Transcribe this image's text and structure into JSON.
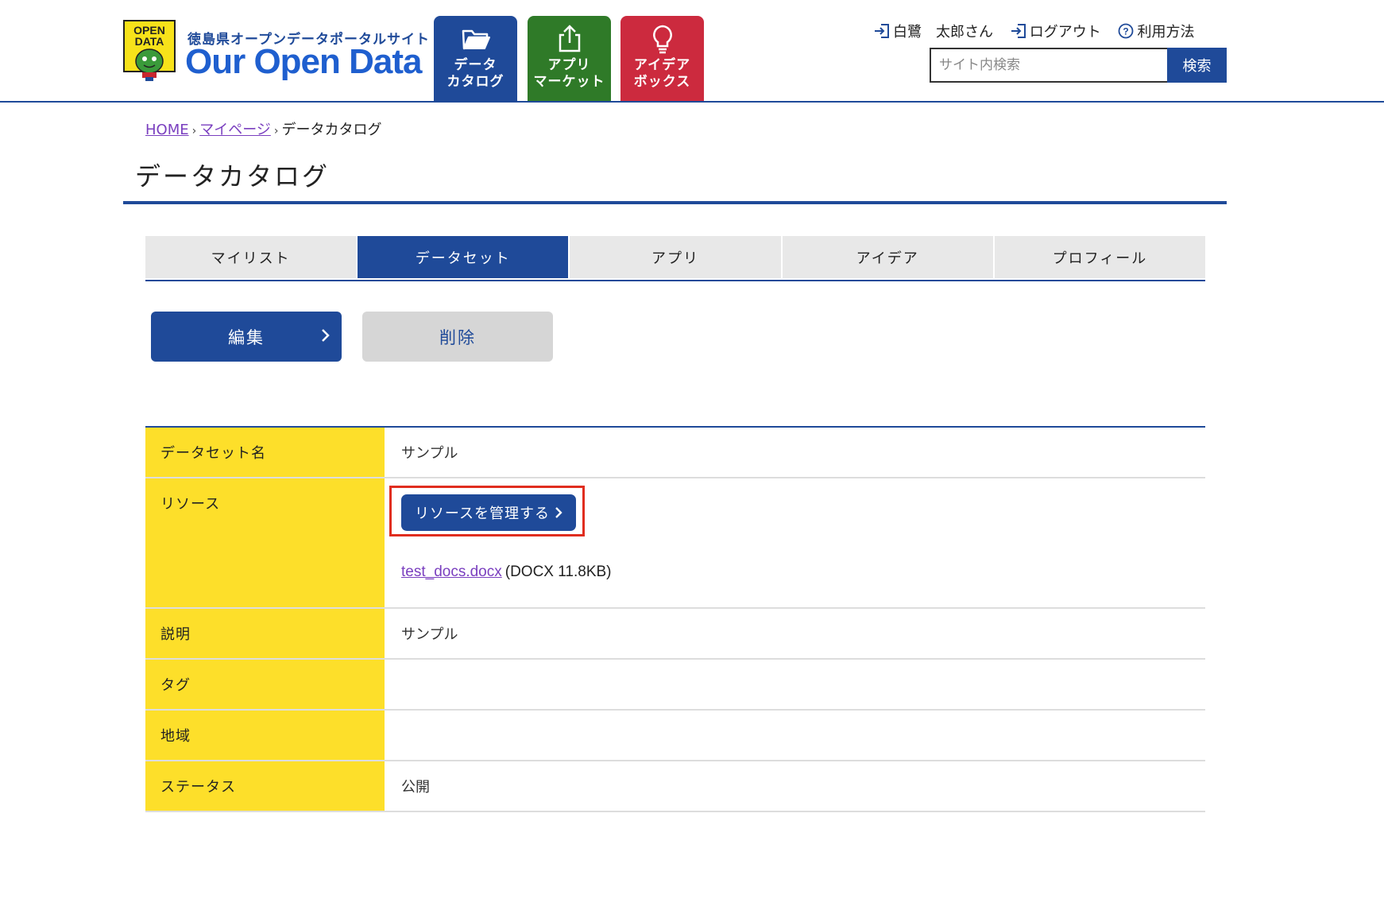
{
  "header": {
    "logo_badge_line1": "OPEN",
    "logo_badge_line2": "DATA",
    "logo_subtitle": "徳島県オープンデータポータルサイト",
    "logo_title": "Our Open Data",
    "nav": [
      {
        "label": "データ\nカタログ",
        "icon": "folder-open-icon",
        "color": "#1f4a99"
      },
      {
        "label": "アプリ\nマーケット",
        "icon": "share-upload-icon",
        "color": "#2f7a28"
      },
      {
        "label": "アイデア\nボックス",
        "icon": "lightbulb-icon",
        "color": "#cc2a3e"
      }
    ],
    "user_links": {
      "user_name": "白鷺　太郎さん",
      "logout": "ログアウト",
      "help": "利用方法"
    },
    "search": {
      "placeholder": "サイト内検索",
      "button": "検索"
    }
  },
  "breadcrumb": {
    "home": "HOME",
    "mypage": "マイページ",
    "current": "データカタログ"
  },
  "page_title": "データカタログ",
  "tabs": [
    {
      "label": "マイリスト",
      "active": false
    },
    {
      "label": "データセット",
      "active": true
    },
    {
      "label": "アプリ",
      "active": false
    },
    {
      "label": "アイデア",
      "active": false
    },
    {
      "label": "プロフィール",
      "active": false
    }
  ],
  "actions": {
    "edit": "編集",
    "delete": "削除"
  },
  "details": {
    "dataset_name_label": "データセット名",
    "dataset_name_value": "サンプル",
    "resource_label": "リソース",
    "manage_resources_button": "リソースを管理する",
    "resource_file_name": "test_docs.docx",
    "resource_file_meta": "(DOCX 11.8KB)",
    "description_label": "説明",
    "description_value": "サンプル",
    "tag_label": "タグ",
    "tag_value": "",
    "area_label": "地域",
    "area_value": "",
    "status_label": "ステータス",
    "status_value": "公開"
  },
  "colors": {
    "primary": "#1f4a99",
    "label_bg": "#fddf2a",
    "highlight": "#e02d1f"
  }
}
